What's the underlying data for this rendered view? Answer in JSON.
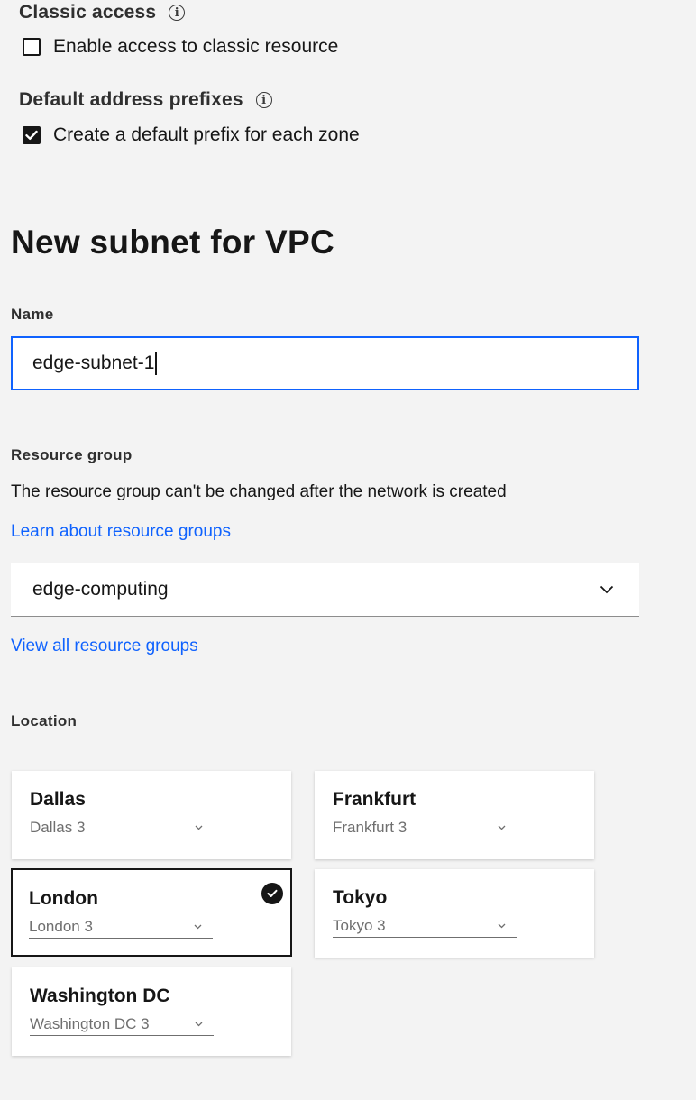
{
  "classic_access": {
    "label": "Classic access",
    "checkbox_label": "Enable access to classic resource",
    "checked": false
  },
  "default_prefixes": {
    "label": "Default address prefixes",
    "checkbox_label": "Create a default prefix for each zone",
    "checked": true
  },
  "subnet": {
    "heading": "New subnet for VPC",
    "name_label": "Name",
    "name_value": "edge-subnet-1"
  },
  "resource_group": {
    "label": "Resource group",
    "helper": "The resource group can't be changed after the network is created",
    "learn_link": "Learn about resource groups",
    "selected": "edge-computing",
    "view_all_link": "View all resource groups"
  },
  "location": {
    "label": "Location",
    "tiles": [
      {
        "name": "Dallas",
        "zone": "Dallas 3",
        "selected": false
      },
      {
        "name": "Frankfurt",
        "zone": "Frankfurt 3",
        "selected": false
      },
      {
        "name": "London",
        "zone": "London 3",
        "selected": true
      },
      {
        "name": "Tokyo",
        "zone": "Tokyo 3",
        "selected": false
      },
      {
        "name": "Washington DC",
        "zone": "Washington DC 3",
        "selected": false
      }
    ]
  },
  "colors": {
    "background": "#f3f3f3",
    "accent": "#0f62fe",
    "text": "#161616"
  }
}
